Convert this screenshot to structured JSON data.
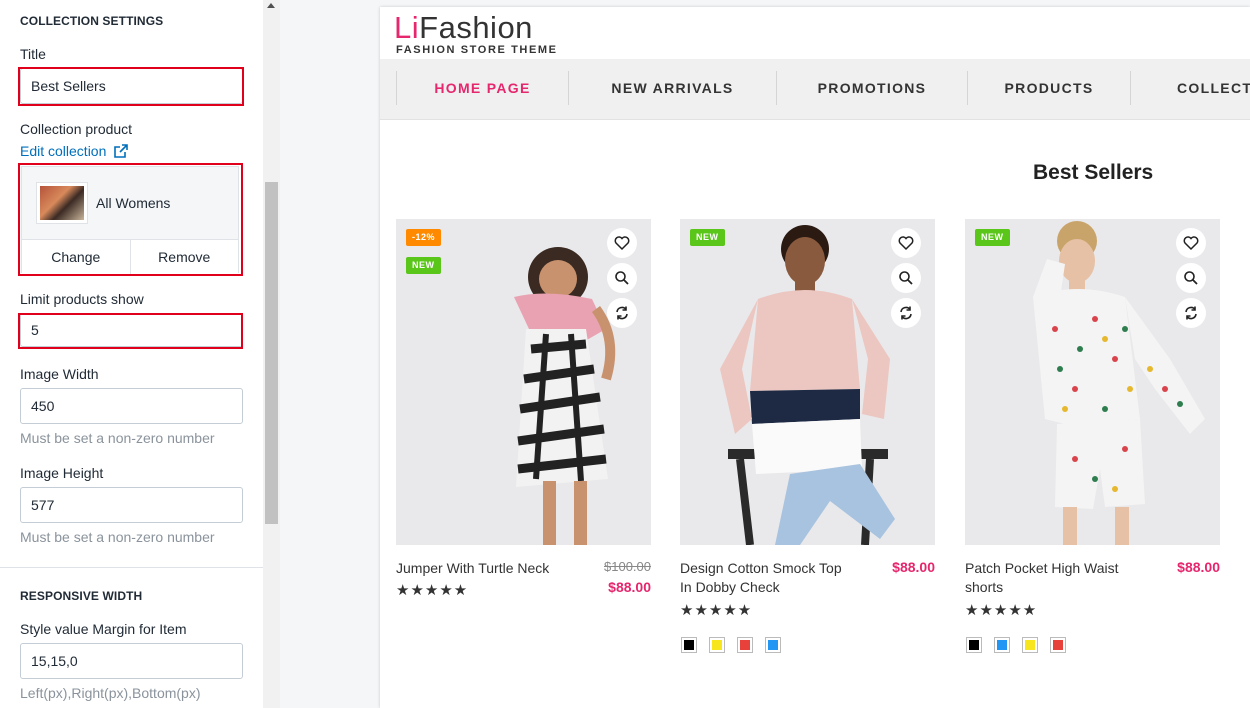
{
  "settings": {
    "collection_heading": "COLLECTION SETTINGS",
    "title_label": "Title",
    "title_value": "Best Sellers",
    "collection_label": "Collection product",
    "edit_collection": "Edit collection",
    "collection_name": "All Womens",
    "change_label": "Change",
    "remove_label": "Remove",
    "limit_label": "Limit products show",
    "limit_value": "5",
    "image_width_label": "Image Width",
    "image_width_value": "450",
    "image_width_hint": "Must be set a non-zero number",
    "image_height_label": "Image Height",
    "image_height_value": "577",
    "image_height_hint": "Must be set a non-zero number",
    "responsive_heading": "RESPONSIVE WIDTH",
    "margin_label": "Style value Margin for Item",
    "margin_value": "15,15,0",
    "margin_hint": "Left(px),Right(px),Bottom(px)"
  },
  "store": {
    "logo_prefix": "Li",
    "logo_rest": "Fashion",
    "logo_sub": "FASHION STORE THEME",
    "nav": [
      "HOME PAGE",
      "NEW ARRIVALS",
      "PROMOTIONS",
      "PRODUCTS",
      "COLLECTIONS"
    ],
    "section_title": "Best Sellers",
    "products": [
      {
        "name": "Jumper With Turtle Neck",
        "old_price": "$100.00",
        "price": "$88.00",
        "badges": [
          "-12%",
          "NEW"
        ],
        "rating": 5
      },
      {
        "name": "Design Cotton Smock Top In Dobby Check",
        "price": "$88.00",
        "badges": [
          "NEW"
        ],
        "rating": 5,
        "swatches": [
          "#000000",
          "#f7e51e",
          "#e8403a",
          "#2196f3"
        ]
      },
      {
        "name": "Patch Pocket High Waist shorts",
        "price": "$88.00",
        "badges": [
          "NEW"
        ],
        "rating": 5,
        "swatches": [
          "#000000",
          "#2196f3",
          "#f7e51e",
          "#e8403a"
        ]
      }
    ],
    "stars_text": "★★★★★"
  },
  "colors": {
    "accent": "#e6266d",
    "sale_badge": "#ff8a00",
    "new_badge": "#5ac619",
    "highlight_border": "#e0001b"
  }
}
